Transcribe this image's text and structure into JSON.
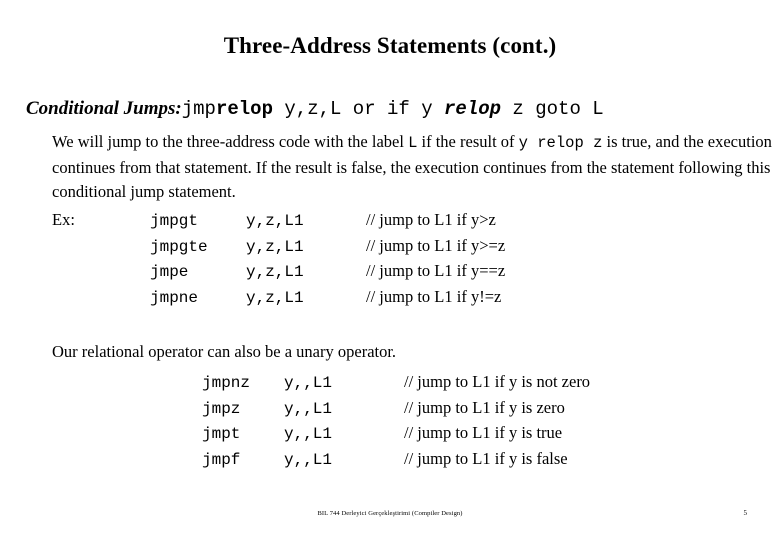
{
  "slide": {
    "title": "Three-Address Statements (cont.)",
    "lead": {
      "label": "Conditional Jumps:",
      "code_plain_1": "jmp",
      "code_bold_1": "relop",
      "code_plain_2": " y,z,L  or  if y ",
      "code_bolditalic": "relop",
      "code_plain_3": " z goto L"
    },
    "paragraph": {
      "seg1": "We will jump to the three-address code with the label ",
      "mono1": "L",
      "seg2": " if the result of ",
      "mono2": "y relop z",
      "seg3": " is true, and the execution continues from that statement. If the result is false, the execution continues from the statement following this conditional jump statement."
    },
    "example_label": "Ex:",
    "examples": [
      {
        "op": "jmpgt",
        "args": "y,z,L1",
        "comment": "// jump to L1 if y>z"
      },
      {
        "op": "jmpgte",
        "args": "y,z,L1",
        "comment": "// jump to L1 if y>=z"
      },
      {
        "op": "jmpe",
        "args": "y,z,L1",
        "comment": "// jump to L1 if y==z"
      },
      {
        "op": "jmpne",
        "args": "y,z,L1",
        "comment": "// jump to L1 if y!=z"
      }
    ],
    "note": "Our relational operator can also be a unary operator.",
    "unary_examples": [
      {
        "op": "jmpnz",
        "args": "y,,L1",
        "comment": "// jump to L1 if y is not zero"
      },
      {
        "op": "jmpz",
        "args": "y,,L1",
        "comment": "// jump to L1 if y is zero"
      },
      {
        "op": "jmpt",
        "args": "y,,L1",
        "comment": "// jump to L1 if y is true"
      },
      {
        "op": "jmpf",
        "args": "y,,L1",
        "comment": "// jump to L1 if y is false"
      }
    ],
    "footer": {
      "text": "BIL 744 Derleyici Gerçekleştirimi (Compiler Design)",
      "page_number": "5"
    },
    "colors": {
      "background": "#ffffff",
      "text": "#000000"
    }
  }
}
